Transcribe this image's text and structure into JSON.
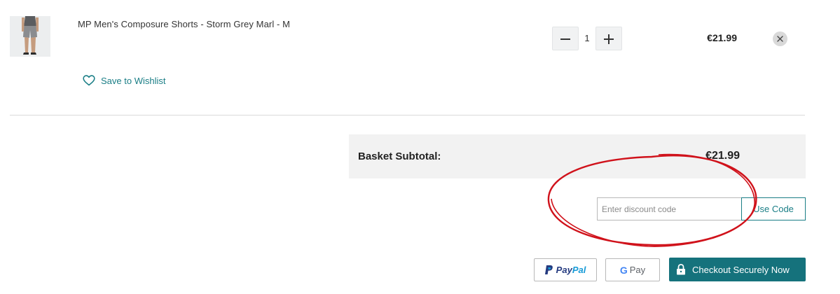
{
  "product": {
    "name": "MP Men's Composure Shorts - Storm Grey Marl - M",
    "thumbnail_icon": "product-photo-shorts",
    "quantity": "1",
    "price": "€21.99",
    "wishlist_label": "Save to Wishlist"
  },
  "summary": {
    "subtotal_label": "Basket Subtotal:",
    "subtotal_value": "€21.99"
  },
  "discount": {
    "placeholder": "Enter discount code",
    "value": "",
    "button_label": "Use Code"
  },
  "payment": {
    "paypal_label_part1": "Pay",
    "paypal_label_part2": "Pal",
    "gpay_label": "Pay",
    "checkout_label": "Checkout Securely Now"
  },
  "colors": {
    "accent": "#1a7e86",
    "checkout_bg": "#15727c",
    "annotation": "#d0121b"
  }
}
